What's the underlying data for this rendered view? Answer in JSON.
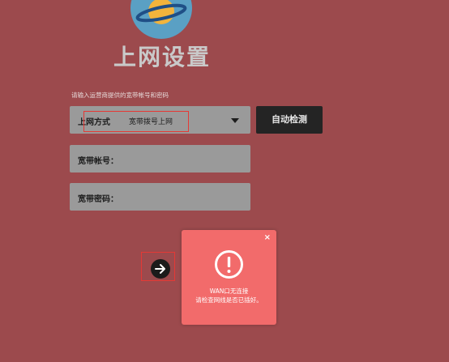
{
  "page_title": "上网设置",
  "hint": "请输入运营商提供的宽带帐号和密码",
  "connection": {
    "label": "上网方式",
    "value": "宽带拨号上网"
  },
  "detect_button": "自动检测",
  "account": {
    "label": "宽带帐号："
  },
  "password": {
    "label": "宽带密码："
  },
  "popup": {
    "close": "×",
    "line1": "WAN口无连接",
    "line2": "请检查网线是否已插好。"
  },
  "colors": {
    "background": "#9c4a4d",
    "popup": "#f26b6b",
    "button": "#242424",
    "highlight": "#e53935"
  },
  "icons": {
    "logo": "planet-logo-icon",
    "next": "arrow-right-icon",
    "alert": "exclamation-circle-icon"
  }
}
